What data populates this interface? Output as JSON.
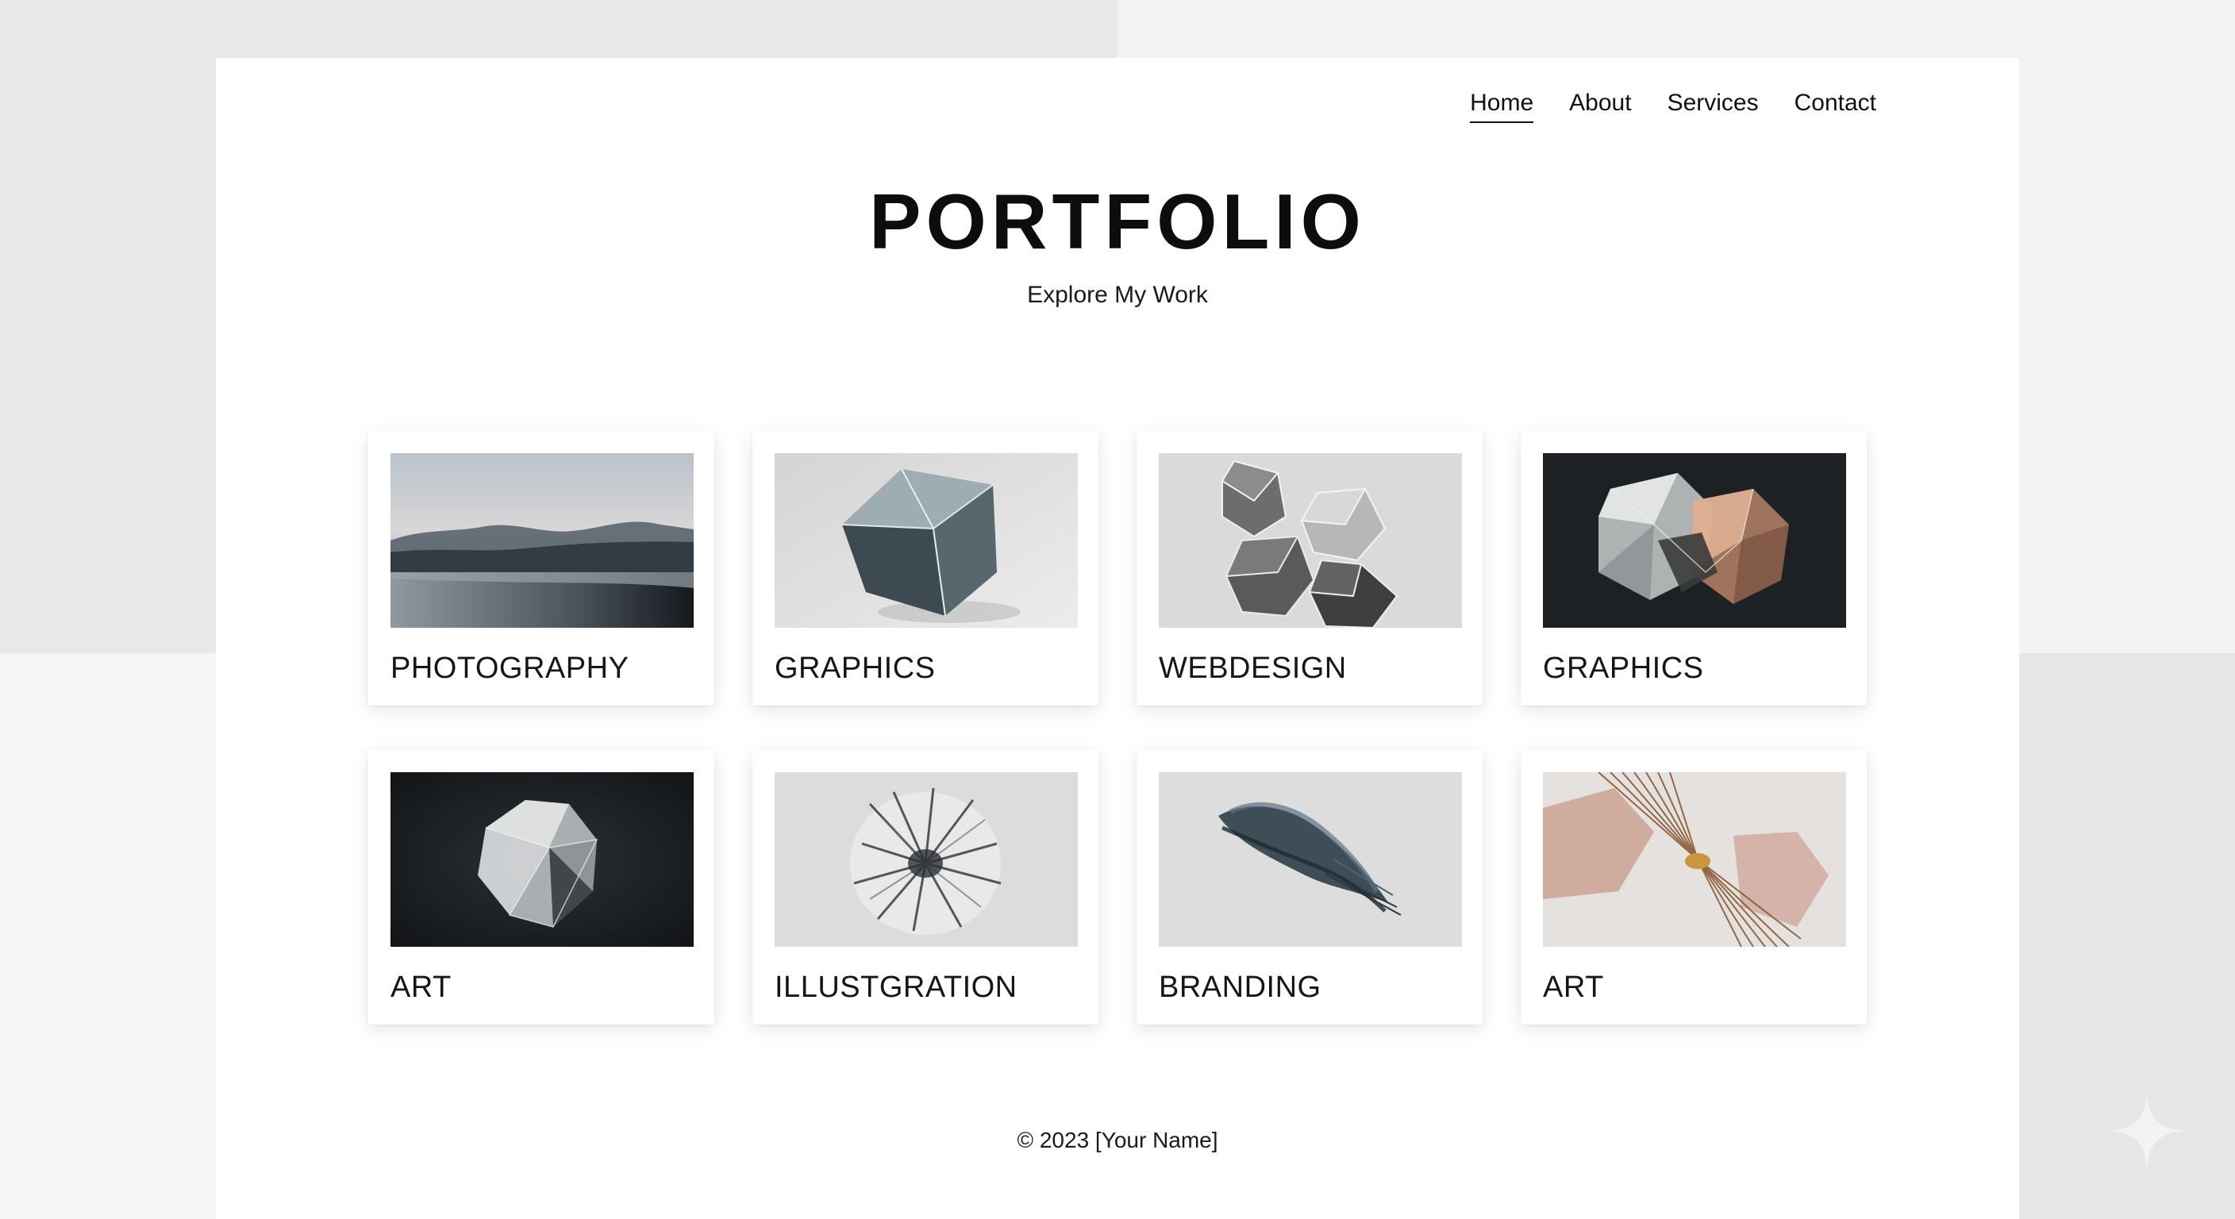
{
  "nav": {
    "items": [
      {
        "label": "Home",
        "active": true
      },
      {
        "label": "About",
        "active": false
      },
      {
        "label": "Services",
        "active": false
      },
      {
        "label": "Contact",
        "active": false
      }
    ]
  },
  "hero": {
    "title": "PORTFOLIO",
    "subtitle": "Explore My Work"
  },
  "cards": [
    {
      "label": "PHOTOGRAPHY",
      "image": "misty-lake-mountains"
    },
    {
      "label": "GRAPHICS",
      "image": "faceted-crystal-cube"
    },
    {
      "label": "WEBDESIGN",
      "image": "geometric-polyhedra-cluster"
    },
    {
      "label": "GRAPHICS",
      "image": "translucent-polyhedra-dark"
    },
    {
      "label": "ART",
      "image": "glass-polyhedron-dark"
    },
    {
      "label": "ILLUSTGRATION",
      "image": "ink-burst-circle"
    },
    {
      "label": "BRANDING",
      "image": "brush-stroke"
    },
    {
      "label": "ART",
      "image": "copper-wire-bundle"
    }
  ],
  "footer": {
    "text": "© 2023 [Your Name]"
  }
}
